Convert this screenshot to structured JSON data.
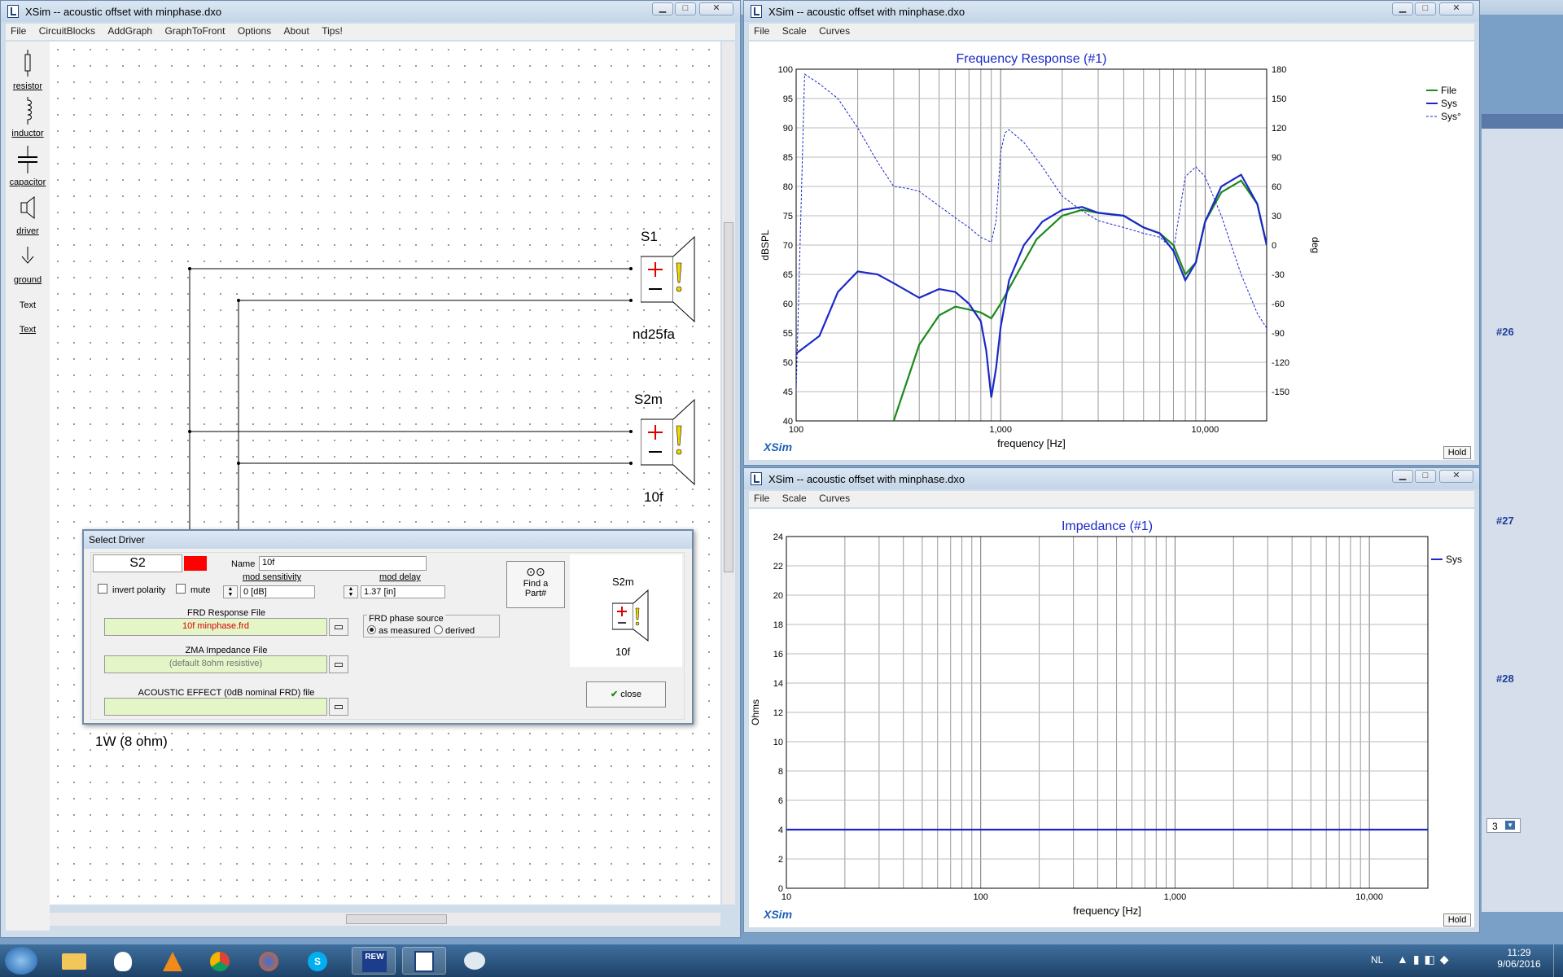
{
  "main_window": {
    "title": "XSim -- acoustic offset with minphase.dxo",
    "menu": [
      "File",
      "CircuitBlocks",
      "AddGraph",
      "GraphToFront",
      "Options",
      "About",
      "Tips!"
    ],
    "tools": [
      "resistor",
      "inductor",
      "capacitor",
      "driver",
      "ground",
      "Text",
      "Text"
    ]
  },
  "schematic": {
    "driver1_name": "S1",
    "driver1_part": "nd25fa",
    "driver2_name": "S2m",
    "driver2_part": "10f",
    "source_label": "1W (8 ohm)"
  },
  "dialog": {
    "title": "Select Driver",
    "driver_id": "S2",
    "name_label": "Name",
    "name_value": "10f",
    "invert_polarity": "invert polarity",
    "mute": "mute",
    "mod_sensitivity_label": "mod sensitivity",
    "mod_sensitivity_value": "0 [dB]",
    "mod_delay_label": "mod delay",
    "mod_delay_value": "1.37 [in]",
    "find_part": "Find a Part#",
    "frd_label": "FRD Response File",
    "frd_value": "10f minphase.frd",
    "frd_phase_label": "FRD phase source",
    "as_measured": "as measured",
    "derived": "derived",
    "zma_label": "ZMA Impedance File",
    "zma_value": "(default 8ohm resistive)",
    "acoustic_label": "ACOUSTIC EFFECT (0dB nominal FRD) file",
    "acoustic_value": "",
    "preview_name": "S2m",
    "preview_part": "10f",
    "close": "close"
  },
  "freq_window": {
    "title": "XSim -- acoustic offset with minphase.dxo",
    "menu": [
      "File",
      "Scale",
      "Curves"
    ],
    "hold": "Hold",
    "brand": "XSim"
  },
  "imp_window": {
    "title": "XSim -- acoustic offset with minphase.dxo",
    "menu": [
      "File",
      "Scale",
      "Curves"
    ],
    "hold": "Hold",
    "brand": "XSim"
  },
  "chart_data": [
    {
      "type": "line",
      "title": "Frequency Response (#1)",
      "xlabel": "frequency [Hz]",
      "ylabel": "dBSPL",
      "y2label": "deg",
      "xscale": "log",
      "xlim": [
        100,
        20000
      ],
      "ylim": [
        40,
        100
      ],
      "y2lim": [
        -180,
        180
      ],
      "x_ticks": [
        "100",
        "1,000",
        "10,000"
      ],
      "y_ticks": [
        40,
        45,
        50,
        55,
        60,
        65,
        70,
        75,
        80,
        85,
        90,
        95,
        100
      ],
      "y2_ticks": [
        180,
        150,
        120,
        90,
        60,
        30,
        0,
        -30,
        -60,
        -90,
        -120,
        -150
      ],
      "legend": "top-right",
      "series": [
        {
          "name": "File",
          "color": "#1a8a1a",
          "x": [
            300,
            350,
            400,
            500,
            600,
            700,
            800,
            900,
            1000,
            1200,
            1500,
            2000,
            2500,
            3000,
            4000,
            5000,
            6000,
            7000,
            8000,
            9000,
            10000,
            12000,
            15000,
            18000,
            20000
          ],
          "y": [
            40,
            47,
            53,
            58,
            59.5,
            59,
            58.5,
            57.5,
            60,
            65,
            71,
            75,
            76,
            75.5,
            75,
            73,
            72,
            70,
            65,
            67,
            74,
            79,
            81,
            77,
            70
          ]
        },
        {
          "name": "Sys",
          "color": "#1a28c8",
          "x": [
            100,
            130,
            160,
            200,
            250,
            300,
            400,
            500,
            600,
            700,
            800,
            850,
            900,
            950,
            1000,
            1100,
            1300,
            1600,
            2000,
            2500,
            3000,
            4000,
            5000,
            6000,
            7000,
            8000,
            9000,
            10000,
            12000,
            15000,
            18000,
            20000
          ],
          "y": [
            51.5,
            54.5,
            62,
            65.5,
            65,
            63.5,
            61,
            62.5,
            62,
            60,
            57,
            52,
            44,
            49,
            56,
            64,
            70,
            74,
            76,
            76.5,
            75.5,
            75,
            73,
            72,
            69,
            64,
            67,
            74,
            80,
            82,
            77,
            70
          ]
        },
        {
          "name": "Sys°",
          "color": "#1a28c8",
          "dashed": true,
          "x": [
            100,
            110,
            130,
            160,
            200,
            250,
            300,
            350,
            400,
            500,
            600,
            700,
            800,
            900,
            950,
            1000,
            1050,
            1100,
            1300,
            1600,
            2000,
            2500,
            3000,
            4000,
            5000,
            6000,
            7000,
            8000,
            9000,
            10000,
            12000,
            15000,
            18000,
            20000
          ],
          "y": [
            -150,
            175,
            165,
            150,
            120,
            85,
            60,
            58,
            55,
            40,
            28,
            18,
            8,
            3,
            25,
            95,
            115,
            118,
            105,
            80,
            50,
            35,
            25,
            18,
            12,
            8,
            -5,
            70,
            80,
            70,
            30,
            -30,
            -70,
            -85
          ]
        }
      ]
    },
    {
      "type": "line",
      "title": "Impedance (#1)",
      "xlabel": "frequency [Hz]",
      "ylabel": "Ohms",
      "xscale": "log",
      "xlim": [
        10,
        20000
      ],
      "ylim": [
        0,
        24
      ],
      "x_ticks": [
        "10",
        "100",
        "1,000",
        "10,000"
      ],
      "y_ticks": [
        0,
        2,
        4,
        6,
        8,
        10,
        12,
        14,
        16,
        18,
        20,
        22,
        24
      ],
      "legend": "top-right",
      "series": [
        {
          "name": "Sys",
          "color": "#1a28c8",
          "x": [
            10,
            20000
          ],
          "y": [
            4,
            4
          ]
        }
      ]
    }
  ],
  "side_panel": {
    "items": [
      "#26",
      "#27",
      "#28"
    ],
    "dropdown": "3"
  },
  "tray": {
    "lang": "NL",
    "time": "11:29",
    "date": "9/06/2016"
  }
}
